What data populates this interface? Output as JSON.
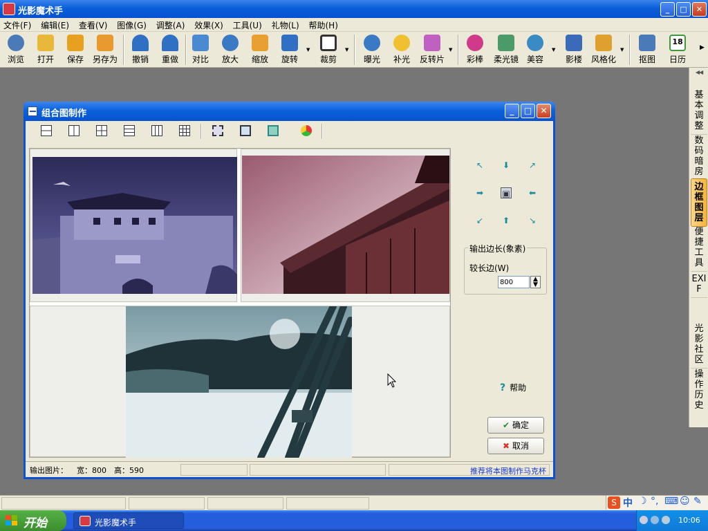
{
  "app": {
    "title": "光影魔术手",
    "window_controls": [
      "_",
      "□",
      "✕"
    ]
  },
  "menu": [
    "文件(F)",
    "编辑(E)",
    "查看(V)",
    "图像(G)",
    "调整(A)",
    "效果(X)",
    "工具(U)",
    "礼物(L)",
    "帮助(H)"
  ],
  "toolbar": [
    {
      "label": "浏览",
      "icon": "browse-icon",
      "color": "#4a7ab8"
    },
    {
      "label": "打开",
      "icon": "folder-open-icon",
      "color": "#e8b83a"
    },
    {
      "label": "保存",
      "icon": "save-icon",
      "color": "#e8a020"
    },
    {
      "label": "另存为",
      "icon": "save-as-icon",
      "color": "#e89a30"
    },
    {
      "label": "撤销",
      "icon": "undo-icon",
      "color": "#2f6fc4"
    },
    {
      "label": "重做",
      "icon": "redo-icon",
      "color": "#2f6fc4"
    },
    {
      "label": "对比",
      "icon": "compare-icon",
      "color": "#4a8ad0"
    },
    {
      "label": "放大",
      "icon": "zoom-in-icon",
      "color": "#3a7ac4"
    },
    {
      "label": "缩放",
      "icon": "resize-icon",
      "color": "#e8a030"
    },
    {
      "label": "旋转",
      "icon": "rotate-icon",
      "color": "#2f6fc4"
    },
    {
      "label": "裁剪",
      "icon": "crop-icon",
      "color": "#333"
    },
    {
      "label": "曝光",
      "icon": "exposure-icon",
      "color": "#3a7ac4"
    },
    {
      "label": "补光",
      "icon": "fill-light-icon",
      "color": "#f0c030"
    },
    {
      "label": "反转片",
      "icon": "reversal-film-icon",
      "color": "#c060c0"
    },
    {
      "label": "彩棒",
      "icon": "color-wand-icon",
      "color": "#d03a8a"
    },
    {
      "label": "柔光镜",
      "icon": "soft-light-icon",
      "color": "#4a9a6a"
    },
    {
      "label": "美容",
      "icon": "beauty-icon",
      "color": "#3a8ac4"
    },
    {
      "label": "影楼",
      "icon": "studio-icon",
      "color": "#3a6ab8"
    },
    {
      "label": "风格化",
      "icon": "stylize-icon",
      "color": "#e0a030"
    },
    {
      "label": "抠图",
      "icon": "cutout-icon",
      "color": "#4a7ab8"
    },
    {
      "label": "日历",
      "icon": "calendar-icon",
      "color": "#3a9a3a",
      "day": "18"
    }
  ],
  "right_panel": {
    "tabs": [
      "基本调整",
      "数码暗房",
      "边框图层",
      "便捷工具",
      "EXIF",
      "光影社区",
      "操作历史"
    ],
    "active": "边框图层"
  },
  "dialog": {
    "title": "组合图制作",
    "layout_tools": [
      "layout-2-horizontal-icon",
      "layout-2-vertical-icon",
      "layout-4-grid-icon",
      "layout-3-rows-icon",
      "layout-3-columns-icon",
      "layout-9-grid-icon",
      "frame-crop-icon",
      "frame-fit-icon",
      "frame-fill-icon",
      "color-wheel-icon"
    ],
    "output": {
      "legend": "输出边长(象素)",
      "longer_side_label": "较长边(W)",
      "value": "800"
    },
    "help": "帮助",
    "ok": "确定",
    "cancel": "取消",
    "status": {
      "label": "输出图片：",
      "width": "宽：800",
      "height": "高：590",
      "link": "推荐将本图制作马克杯"
    }
  },
  "taskbar": {
    "start": "开始",
    "task": "光影魔术手",
    "clock": "10:06"
  }
}
